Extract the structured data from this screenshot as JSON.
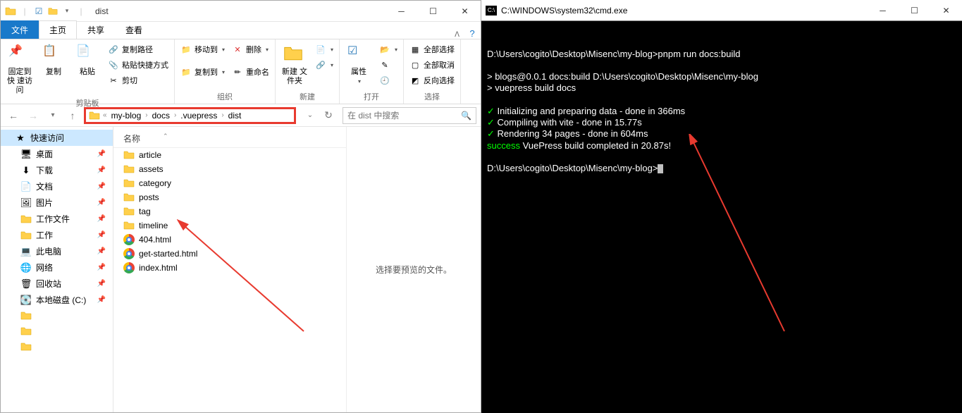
{
  "explorer": {
    "title": "dist",
    "tabs": {
      "file": "文件",
      "home": "主页",
      "share": "共享",
      "view": "查看"
    },
    "ribbon": {
      "pin": "固定到快\n速访问",
      "copy": "复制",
      "paste": "粘贴",
      "copypath": "复制路径",
      "pasteshortcut": "粘贴快捷方式",
      "cut": "剪切",
      "group_clipboard": "剪贴板",
      "moveto": "移动到",
      "copyto": "复制到",
      "delete": "删除",
      "rename": "重命名",
      "group_organize": "组织",
      "newfolder": "新建\n文件夹",
      "group_new": "新建",
      "properties": "属性",
      "group_open": "打开",
      "selectall": "全部选择",
      "selectnone": "全部取消",
      "selectinvert": "反向选择",
      "group_select": "选择"
    },
    "breadcrumb": [
      "my-blog",
      "docs",
      ".vuepress",
      "dist"
    ],
    "search_placeholder": "在 dist 中搜索",
    "sidebar": [
      {
        "icon": "star",
        "label": "快速访问",
        "active": true,
        "indent": 0
      },
      {
        "icon": "desktop",
        "label": "桌面",
        "pin": true,
        "indent": 1
      },
      {
        "icon": "download",
        "label": "下载",
        "pin": true,
        "indent": 1
      },
      {
        "icon": "document",
        "label": "文档",
        "pin": true,
        "indent": 1
      },
      {
        "icon": "picture",
        "label": "图片",
        "pin": true,
        "indent": 1
      },
      {
        "icon": "folder",
        "label": "工作文件",
        "pin": true,
        "indent": 1
      },
      {
        "icon": "folder",
        "label": "工作",
        "pin": true,
        "indent": 1
      },
      {
        "icon": "pc",
        "label": "此电脑",
        "pin": true,
        "indent": 1
      },
      {
        "icon": "network",
        "label": "网络",
        "pin": true,
        "indent": 1
      },
      {
        "icon": "recycle",
        "label": "回收站",
        "pin": true,
        "indent": 1
      },
      {
        "icon": "disk",
        "label": "本地磁盘 (C:)",
        "pin": true,
        "indent": 1
      },
      {
        "icon": "folder",
        "label": "",
        "indent": 1
      },
      {
        "icon": "folder",
        "label": "",
        "indent": 1
      },
      {
        "icon": "folder",
        "label": "",
        "indent": 1
      }
    ],
    "column_header": "名称",
    "files": [
      {
        "type": "folder",
        "name": "article"
      },
      {
        "type": "folder",
        "name": "assets"
      },
      {
        "type": "folder",
        "name": "category"
      },
      {
        "type": "folder",
        "name": "posts"
      },
      {
        "type": "folder",
        "name": "tag"
      },
      {
        "type": "folder",
        "name": "timeline"
      },
      {
        "type": "html",
        "name": "404.html"
      },
      {
        "type": "html",
        "name": "get-started.html"
      },
      {
        "type": "html",
        "name": "index.html"
      }
    ],
    "preview_text": "选择要预览的文件。"
  },
  "cmd": {
    "title": "C:\\WINDOWS\\system32\\cmd.exe",
    "lines": [
      {
        "cls": "white",
        "text": "D:\\Users\\cogito\\Desktop\\Misenc\\my-blog>pnpm run docs:build"
      },
      {
        "cls": "",
        "text": ""
      },
      {
        "cls": "white",
        "text": "> blogs@0.0.1 docs:build D:\\Users\\cogito\\Desktop\\Misenc\\my-blog"
      },
      {
        "cls": "white",
        "text": "> vuepress build docs"
      },
      {
        "cls": "",
        "text": ""
      },
      {
        "cls": "green",
        "prefix": "✓ ",
        "text": "Initializing and preparing data - done in 366ms"
      },
      {
        "cls": "green",
        "prefix": "✓ ",
        "text": "Compiling with vite - done in 15.77s"
      },
      {
        "cls": "green",
        "prefix": "✓ ",
        "text": "Rendering 34 pages - done in 604ms"
      },
      {
        "cls": "success",
        "text": "success VuePress build completed in 20.87s!"
      },
      {
        "cls": "",
        "text": ""
      },
      {
        "cls": "white",
        "text": "D:\\Users\\cogito\\Desktop\\Misenc\\my-blog>",
        "cursor": true
      }
    ]
  }
}
